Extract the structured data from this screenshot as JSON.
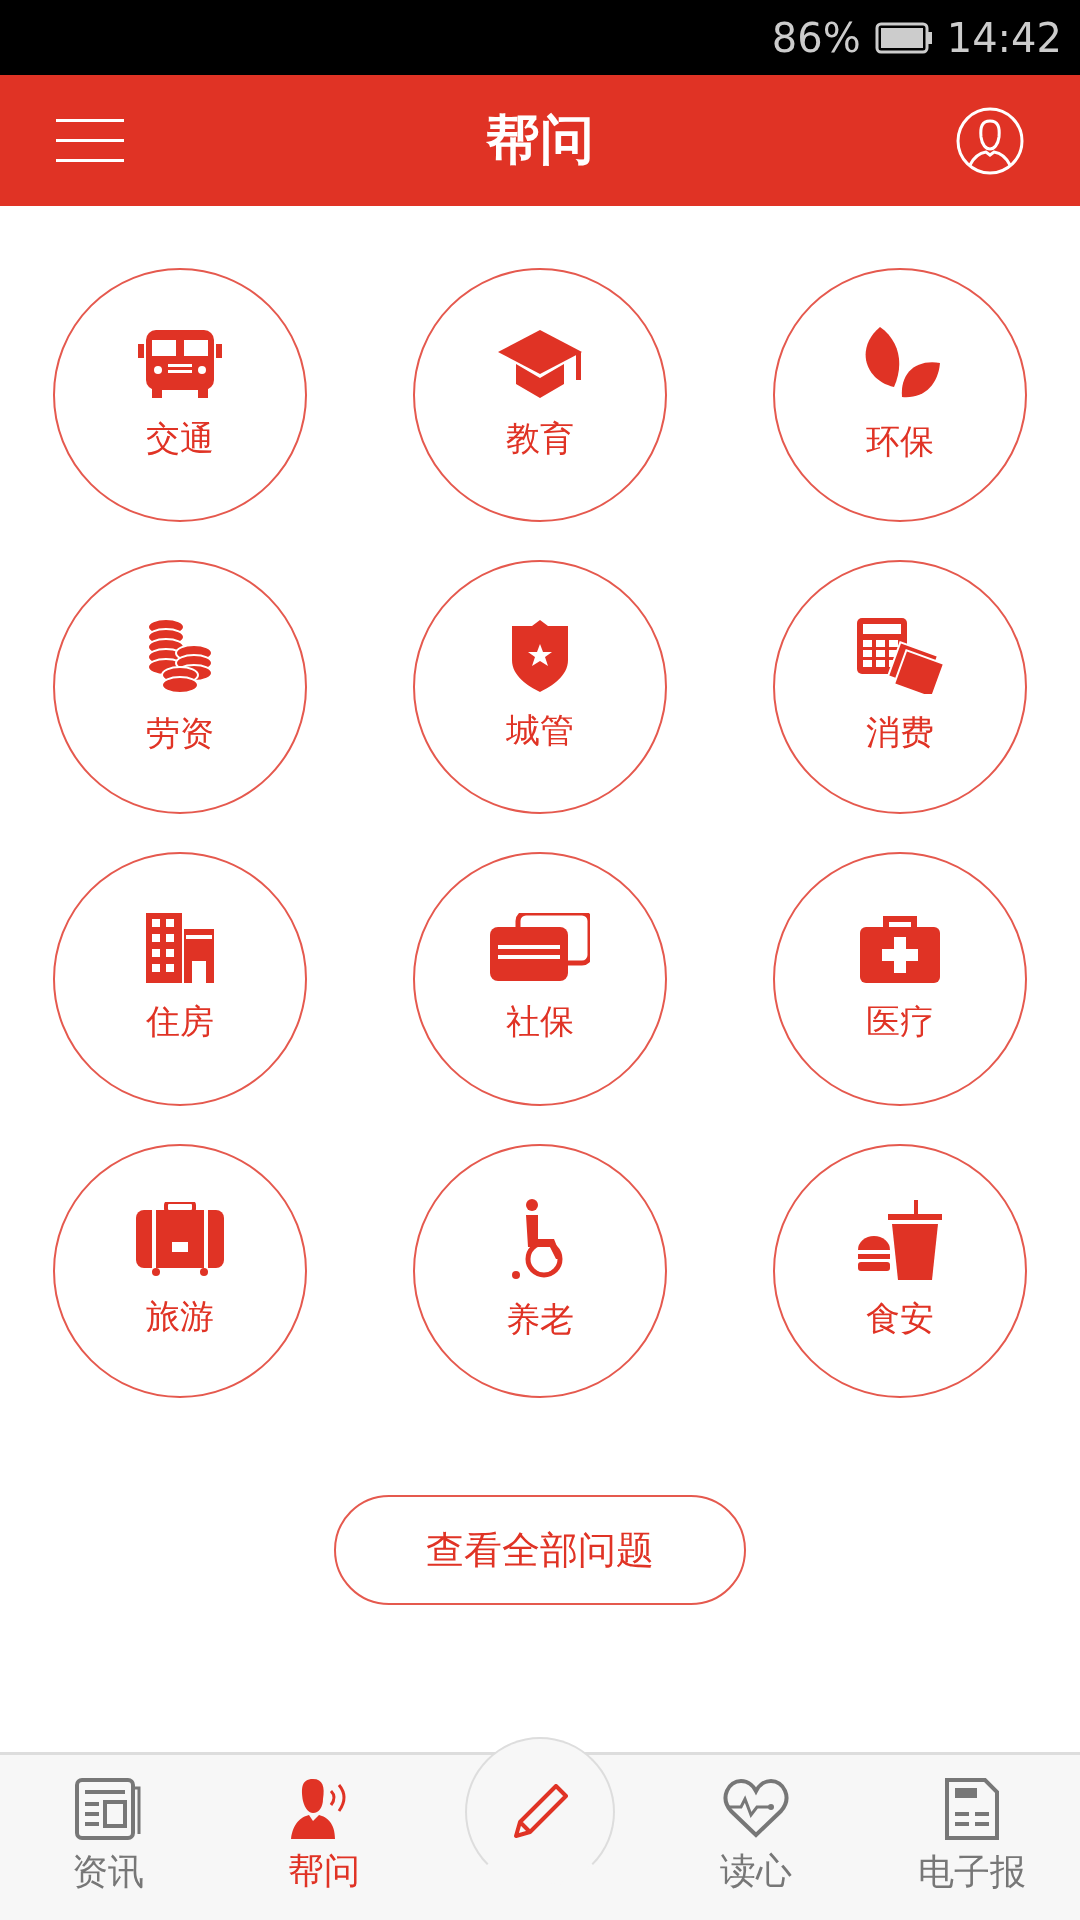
{
  "status_bar": {
    "battery": "86%",
    "time": "14:42"
  },
  "header": {
    "title": "帮问"
  },
  "categories": [
    {
      "label": "交通"
    },
    {
      "label": "教育"
    },
    {
      "label": "环保"
    },
    {
      "label": "劳资"
    },
    {
      "label": "城管"
    },
    {
      "label": "消费"
    },
    {
      "label": "住房"
    },
    {
      "label": "社保"
    },
    {
      "label": "医疗"
    },
    {
      "label": "旅游"
    },
    {
      "label": "养老"
    },
    {
      "label": "食安"
    }
  ],
  "all_questions_button": "查看全部问题",
  "bottom_nav": [
    {
      "kind": "tab",
      "label": "资讯",
      "selected": false
    },
    {
      "kind": "tab",
      "label": "帮问",
      "selected": true
    },
    {
      "kind": "compose"
    },
    {
      "kind": "tab",
      "label": "读心",
      "selected": false
    },
    {
      "kind": "tab",
      "label": "电子报",
      "selected": false
    }
  ]
}
